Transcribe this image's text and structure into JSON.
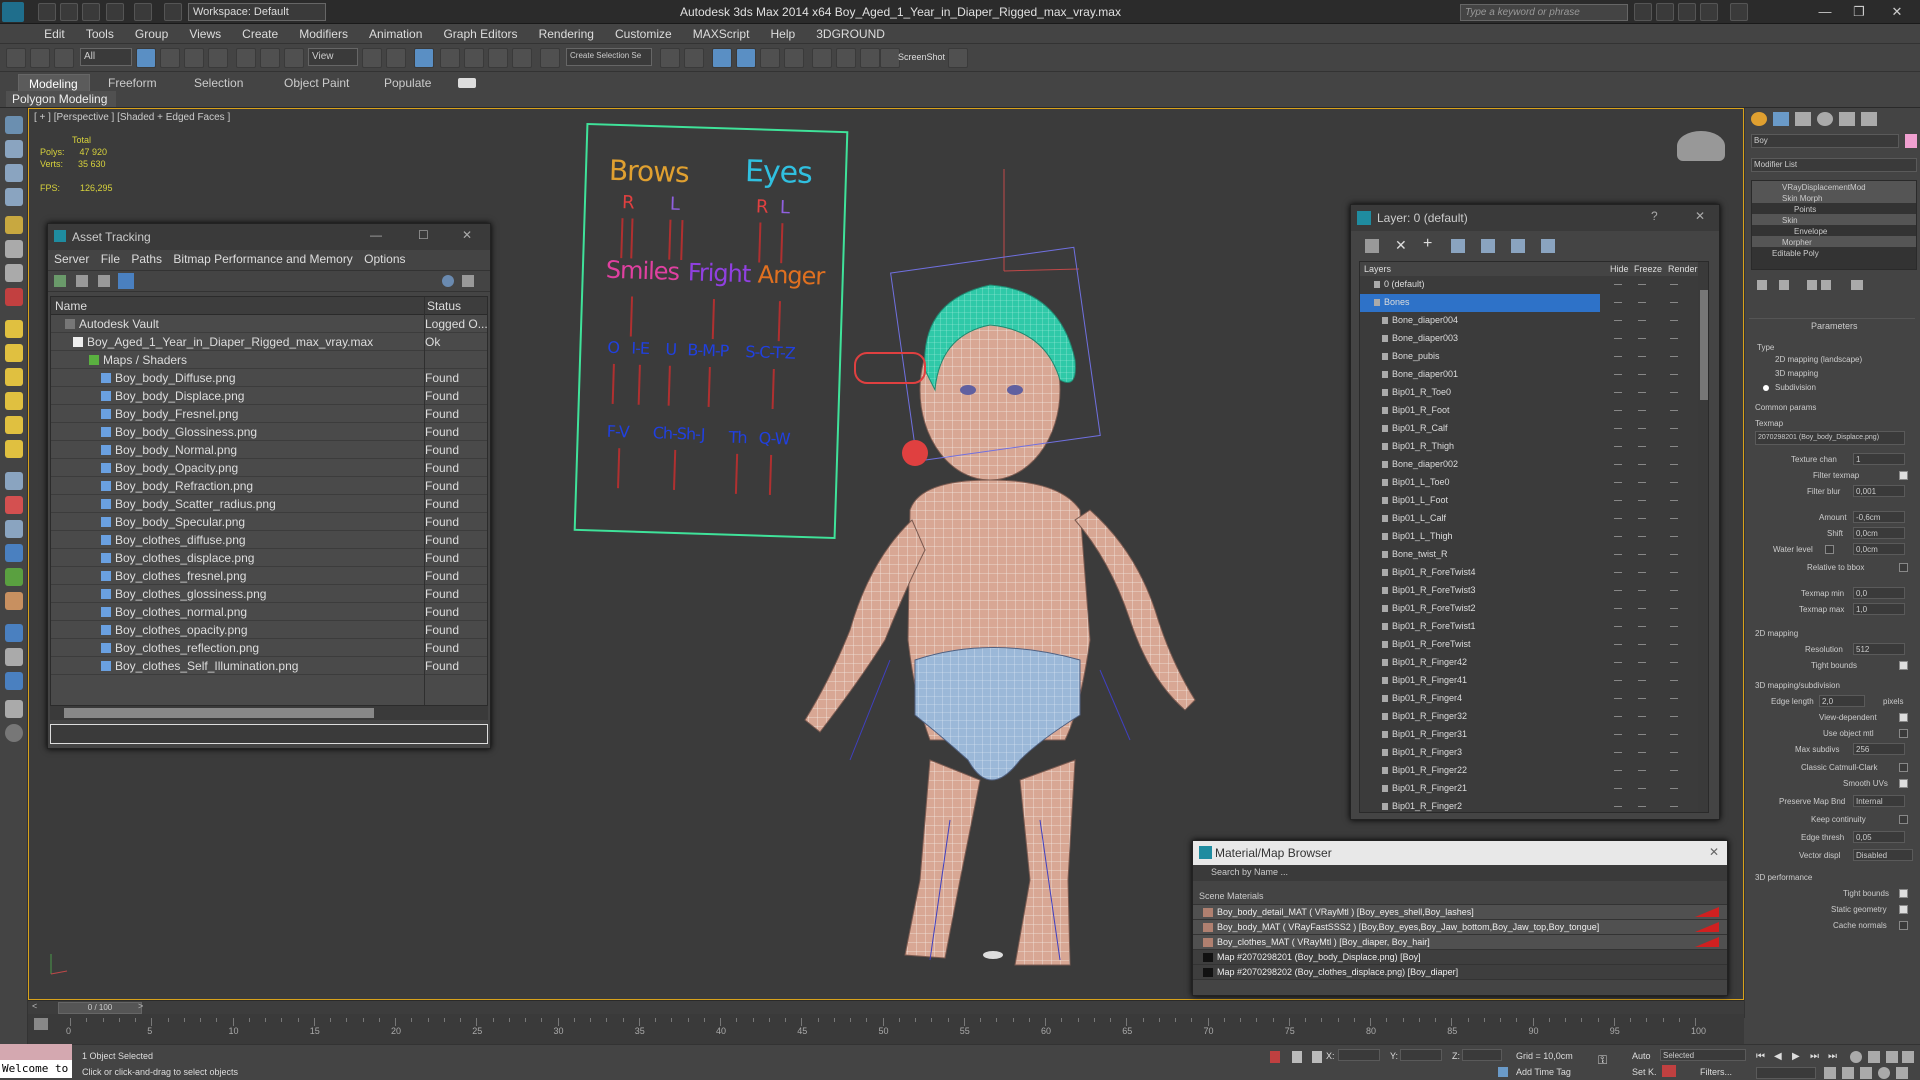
{
  "app": {
    "title": "Autodesk 3ds Max  2014 x64     Boy_Aged_1_Year_in_Diaper_Rigged_max_vray.max",
    "workspace": "Workspace: Default",
    "search_placeholder": "Type a keyword or phrase"
  },
  "menu": [
    "Edit",
    "Tools",
    "Group",
    "Views",
    "Create",
    "Modifiers",
    "Animation",
    "Graph Editors",
    "Rendering",
    "Customize",
    "MAXScript",
    "Help",
    "3DGROUND"
  ],
  "toolbar": {
    "filter": "All",
    "view": "View",
    "selection_set": "Create Selection Se",
    "screenshot": "ScreenShot"
  },
  "ribbon": {
    "tabs": [
      "Modeling",
      "Freeform",
      "Selection",
      "Object Paint",
      "Populate"
    ],
    "sub": "Polygon Modeling"
  },
  "viewport": {
    "label": "[ + ] [Perspective ] [Shaded + Edged Faces ]",
    "stats": {
      "total": "Total",
      "polys_lbl": "Polys:",
      "polys": "47 920",
      "verts_lbl": "Verts:",
      "verts": "35 630",
      "fps_lbl": "FPS:",
      "fps": "126,295"
    }
  },
  "face_rig": {
    "brows": "Brows",
    "eyes": "Eyes",
    "r1": "R",
    "l1": "L",
    "r2": "R",
    "l2": "L",
    "smiles": "Smiles",
    "fright": "Fright",
    "anger": "Anger",
    "p1": "O",
    "p2": "I-E",
    "p3": "U",
    "p4": "B-M-P",
    "p5": "S-C-T-Z",
    "p6": "F-V",
    "p7": "Ch-Sh-J",
    "p8": "Th",
    "p9": "Q-W"
  },
  "asset_tracking": {
    "title": "Asset Tracking",
    "menu": [
      "Server",
      "File",
      "Paths",
      "Bitmap Performance and Memory",
      "Options"
    ],
    "col_name": "Name",
    "col_status": "Status",
    "rows": [
      {
        "name": "Autodesk Vault",
        "status": "Logged O..."
      },
      {
        "name": "Boy_Aged_1_Year_in_Diaper_Rigged_max_vray.max",
        "status": "Ok"
      },
      {
        "name": "Maps / Shaders",
        "status": ""
      },
      {
        "name": "Boy_body_Diffuse.png",
        "status": "Found"
      },
      {
        "name": "Boy_body_Displace.png",
        "status": "Found"
      },
      {
        "name": "Boy_body_Fresnel.png",
        "status": "Found"
      },
      {
        "name": "Boy_body_Glossiness.png",
        "status": "Found"
      },
      {
        "name": "Boy_body_Normal.png",
        "status": "Found"
      },
      {
        "name": "Boy_body_Opacity.png",
        "status": "Found"
      },
      {
        "name": "Boy_body_Refraction.png",
        "status": "Found"
      },
      {
        "name": "Boy_body_Scatter_radius.png",
        "status": "Found"
      },
      {
        "name": "Boy_body_Specular.png",
        "status": "Found"
      },
      {
        "name": "Boy_clothes_diffuse.png",
        "status": "Found"
      },
      {
        "name": "Boy_clothes_displace.png",
        "status": "Found"
      },
      {
        "name": "Boy_clothes_fresnel.png",
        "status": "Found"
      },
      {
        "name": "Boy_clothes_glossiness.png",
        "status": "Found"
      },
      {
        "name": "Boy_clothes_normal.png",
        "status": "Found"
      },
      {
        "name": "Boy_clothes_opacity.png",
        "status": "Found"
      },
      {
        "name": "Boy_clothes_reflection.png",
        "status": "Found"
      },
      {
        "name": "Boy_clothes_Self_Illumination.png",
        "status": "Found"
      }
    ]
  },
  "layer_window": {
    "title": "Layer: 0 (default)",
    "col_layers": "Layers",
    "col_hide": "Hide",
    "col_freeze": "Freeze",
    "col_render": "Render",
    "rows": [
      "0 (default)",
      "Bones",
      "Bone_diaper004",
      "Bone_diaper003",
      "Bone_pubis",
      "Bone_diaper001",
      "Bip01_R_Toe0",
      "Bip01_R_Foot",
      "Bip01_R_Calf",
      "Bip01_R_Thigh",
      "Bone_diaper002",
      "Bip01_L_Toe0",
      "Bip01_L_Foot",
      "Bip01_L_Calf",
      "Bip01_L_Thigh",
      "Bone_twist_R",
      "Bip01_R_ForeTwist4",
      "Bip01_R_ForeTwist3",
      "Bip01_R_ForeTwist2",
      "Bip01_R_ForeTwist1",
      "Bip01_R_ForeTwist",
      "Bip01_R_Finger42",
      "Bip01_R_Finger41",
      "Bip01_R_Finger4",
      "Bip01_R_Finger32",
      "Bip01_R_Finger31",
      "Bip01_R_Finger3",
      "Bip01_R_Finger22",
      "Bip01_R_Finger21",
      "Bip01_R_Finger2"
    ]
  },
  "material_browser": {
    "title": "Material/Map Browser",
    "search": "Search by Name ...",
    "group": "Scene Materials",
    "rows": [
      "Boy_body_detail_MAT ( VRayMtl ) [Boy_eyes_shell,Boy_lashes]",
      "Boy_body_MAT ( VRayFastSSS2 ) [Boy,Boy_eyes,Boy_Jaw_bottom,Boy_Jaw_top,Boy_tongue]",
      "Boy_clothes_MAT ( VRayMtl ) [Boy_diaper, Boy_hair]",
      "Map #2070298201 (Boy_body_Displace.png) [Boy]",
      "Map #2070298202 (Boy_clothes_displace.png) [Boy_diaper]"
    ]
  },
  "command_panel": {
    "object_name": "Boy",
    "modifier_list": "Modifier List",
    "stack": [
      "VRayDisplacementMod",
      "Skin Morph",
      "Points",
      "Skin",
      "Envelope",
      "Morpher",
      "Editable Poly"
    ],
    "parameters": "Parameters",
    "type": "Type",
    "type_opts": [
      "2D mapping (landscape)",
      "3D mapping",
      "Subdivision"
    ],
    "common": "Common params",
    "texmap": "Texmap",
    "texmap_val": "2070298201 (Boy_body_Displace.png)",
    "texture_chan": "Texture chan",
    "texture_chan_val": "1",
    "filter_texmap": "Filter texmap",
    "filter_blur": "Filter blur",
    "filter_blur_val": "0,001",
    "amount": "Amount",
    "amount_val": "-0,6cm",
    "shift": "Shift",
    "shift_val": "0,0cm",
    "water_level": "Water level",
    "water_val": "0,0cm",
    "rel_bbox": "Relative to bbox",
    "texmap_min": "Texmap min",
    "texmap_min_val": "0,0",
    "texmap_max": "Texmap max",
    "texmap_max_val": "1,0",
    "mapping2d": "2D mapping",
    "resolution": "Resolution",
    "resolution_val": "512",
    "tight_bounds": "Tight bounds",
    "mapping3d": "3D mapping/subdivision",
    "edge_length": "Edge length",
    "edge_length_val": "2,0",
    "pixels": "pixels",
    "view_dependent": "View-dependent",
    "use_object_mtl": "Use object mtl",
    "max_subdivs": "Max subdivs",
    "max_subdivs_val": "256",
    "classic_cc": "Classic Catmull-Clark",
    "smooth_uvs": "Smooth UVs",
    "preserve_map": "Preserve Map Bnd",
    "preserve_val": "Internal",
    "keep_cont": "Keep continuity",
    "edge_thresh": "Edge thresh",
    "edge_thresh_val": "0,05",
    "vector_disp": "Vector displ",
    "vector_val": "Disabled",
    "perf": "3D performance",
    "tight_bounds2": "Tight bounds",
    "static_geo": "Static geometry",
    "cache_normals": "Cache normals"
  },
  "timeline": {
    "frame": "0 / 100",
    "ticks": [
      "0",
      "5",
      "10",
      "15",
      "20",
      "25",
      "30",
      "35",
      "40",
      "45",
      "50",
      "55",
      "60",
      "65",
      "70",
      "75",
      "80",
      "85",
      "90",
      "95",
      "100"
    ]
  },
  "status": {
    "selected": "1 Object Selected",
    "hint": "Click or click-and-drag to select objects",
    "welcome": "Welcome to",
    "x": "X:",
    "y": "Y:",
    "z": "Z:",
    "grid": "Grid = 10,0cm",
    "add_time_tag": "Add Time Tag",
    "auto": "Auto",
    "selected_drop": "Selected",
    "setk": "Set K.",
    "filters": "Filters..."
  }
}
